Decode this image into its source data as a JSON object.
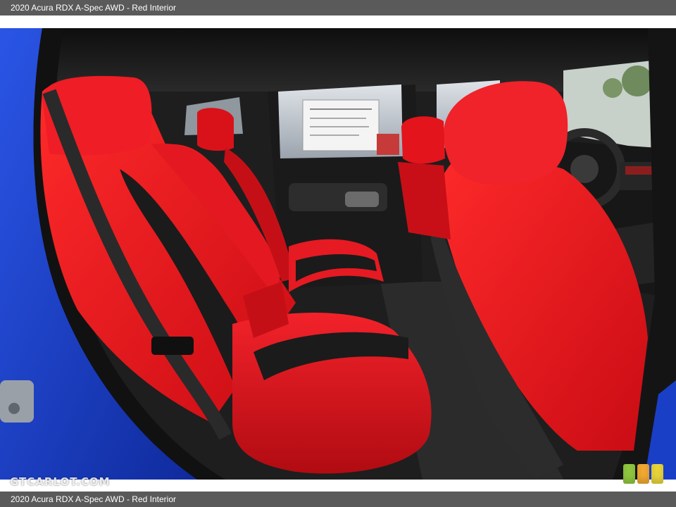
{
  "caption": {
    "text": "2020 Acura RDX A-Spec AWD - Red Interior"
  },
  "photo": {
    "subject": "rear seat interior photo",
    "watermark": "GTCARLOT.COM"
  },
  "colors": {
    "caption_bar": "#5a5a5a",
    "caption_text": "#ffffff",
    "seat_red": "#e3141c",
    "suede_black": "#1b1b1b",
    "body_blue": "#1a3fc7",
    "badge_green": "#8fc63f",
    "badge_orange": "#f0a830",
    "badge_yellow": "#e6d33a"
  },
  "badge": {
    "icon": "color-swatch-icon"
  }
}
